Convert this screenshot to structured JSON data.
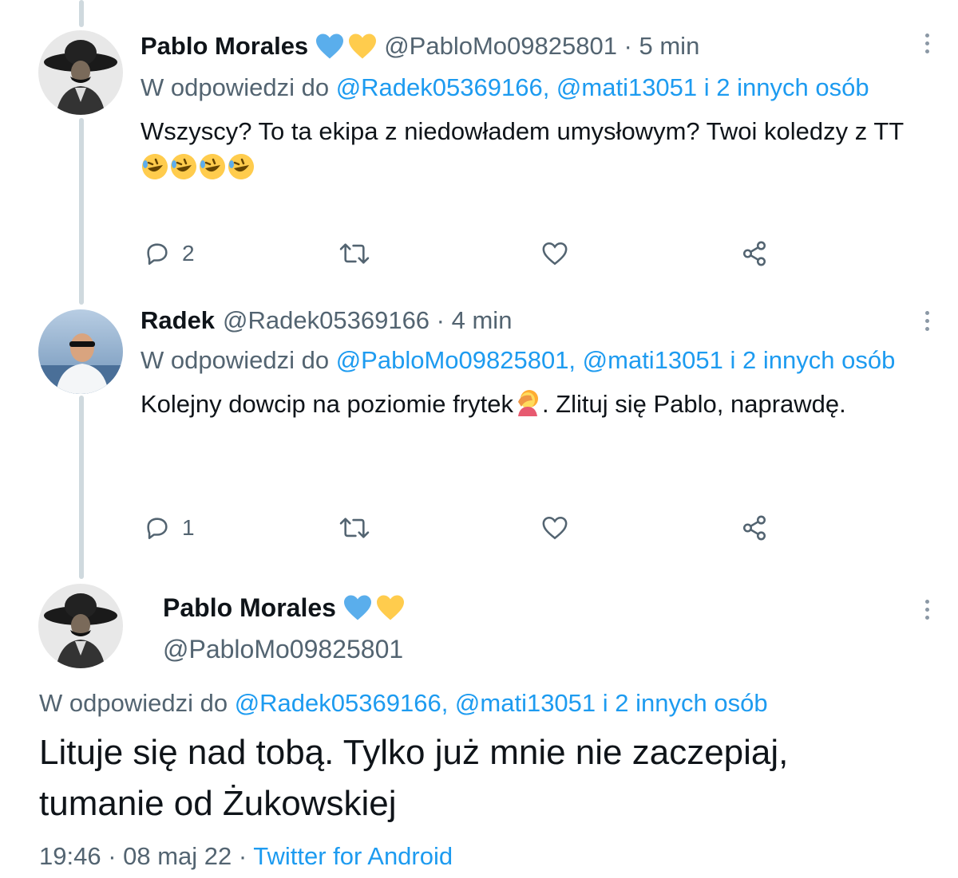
{
  "tweets": [
    {
      "name": "Pablo Morales",
      "handle": "@PabloMo09825801",
      "sep": " · ",
      "time": "5 min",
      "reply_prefix": "W odpowiedzi do ",
      "reply_mentions": "@Radek05369166, @mati13051 i 2 innych osób",
      "text": "Wszyscy? To ta ekipa z niedowładem umysłowym? Twoi koledzy z TT",
      "emoji": [
        "rolling-laughing",
        "rolling-laughing",
        "rolling-laughing",
        "rolling-laughing"
      ],
      "replies": "2"
    },
    {
      "name": "Radek",
      "handle": "@Radek05369166",
      "sep": " · ",
      "time": "4 min",
      "reply_prefix": "W odpowiedzi do ",
      "reply_mentions": "@PabloMo09825801, @mati13051 i 2 innych osób",
      "text_before": "Kolejny dowcip na poziomie frytek",
      "text_after": ". Zlituj się Pablo, naprawdę.",
      "emoji": [
        "facepalm"
      ],
      "replies": "1"
    }
  ],
  "main": {
    "name": "Pablo Morales",
    "handle": "@PabloMo09825801",
    "reply_prefix": "W odpowiedzi do ",
    "reply_mentions": "@Radek05369166, @mati13051 i 2 innych osób",
    "text": "Lituje się nad tobą. Tylko już mnie nie zaczepiaj, tumanie od Żukowskiej",
    "time": "19:46",
    "sep1": " · ",
    "date": "08 maj 22",
    "sep2": " · ",
    "source": "Twitter for Android"
  },
  "colors": {
    "link": "#1d9bf0",
    "secondary": "#536471",
    "heart_blue": "#5aaeec",
    "heart_yellow": "#ffcc4d"
  },
  "icons": [
    "blue-heart-icon",
    "yellow-heart-icon",
    "reply-icon",
    "retweet-icon",
    "like-icon",
    "share-icon",
    "more-icon"
  ]
}
